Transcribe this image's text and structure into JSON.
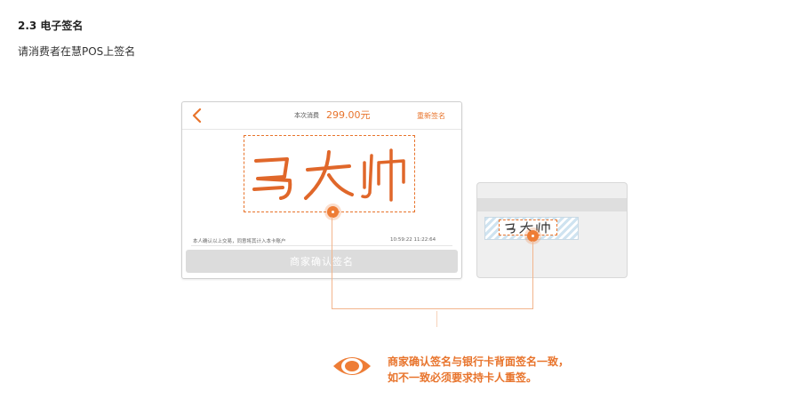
{
  "section": {
    "heading": "2.3 电子签名",
    "intro": "请消费者在慧POS上签名"
  },
  "pos": {
    "amount_label": "本次消费",
    "amount_value": "299.00元",
    "resign_label": "重新签名",
    "signature": "马大帅",
    "note": "本人确认以上交易，同意将其计入本卡账户",
    "time": "10:59:22  11:22:64",
    "confirm_label": "商家确认签名",
    "back_icon": "chevron-left-icon"
  },
  "card": {
    "signature": "马大帅"
  },
  "message": {
    "line1": "商家确认签名与银行卡背面签名一致，",
    "line2": "如不一致必须要求持卡人重签。",
    "icon": "eye-icon"
  },
  "colors": {
    "accent": "#e8742c",
    "button_disabled": "#dcdcdc"
  }
}
